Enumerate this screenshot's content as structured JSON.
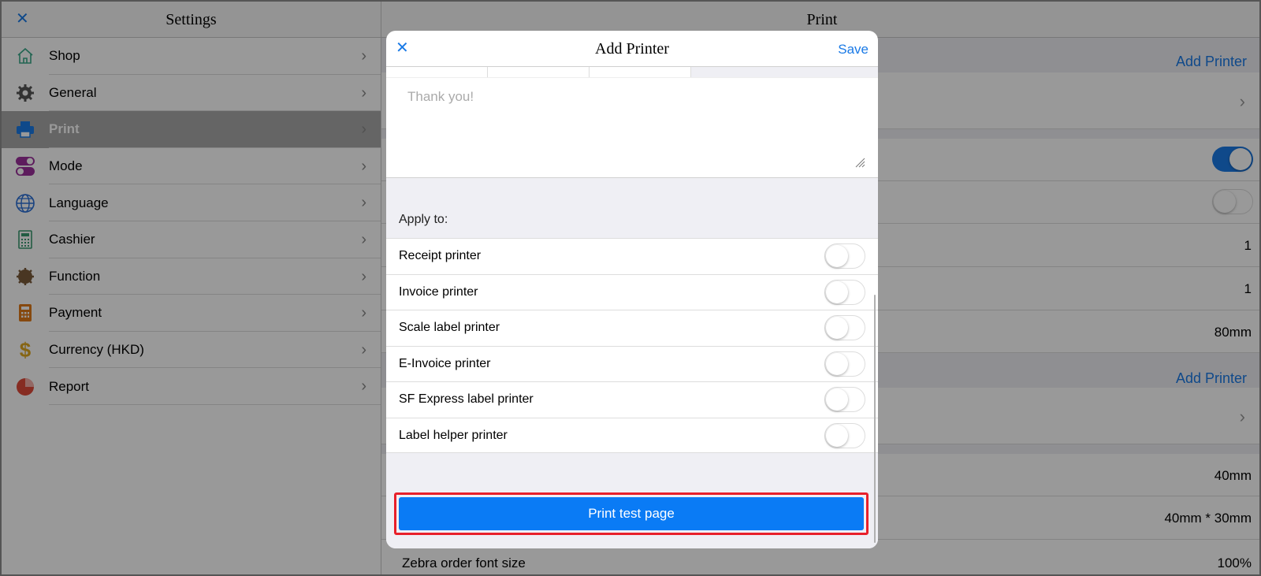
{
  "left_panel": {
    "title": "Settings",
    "items": [
      {
        "label": "Shop",
        "icon": "shop-icon",
        "color": "#3aa889"
      },
      {
        "label": "General",
        "icon": "gear-icon",
        "color": "#555555"
      },
      {
        "label": "Print",
        "icon": "printer-icon",
        "color": "#1a7ae6"
      },
      {
        "label": "Mode",
        "icon": "toggle-icon",
        "color": "#9b2f9b"
      },
      {
        "label": "Language",
        "icon": "globe-icon",
        "color": "#2a6fd6"
      },
      {
        "label": "Cashier",
        "icon": "calculator-icon",
        "color": "#3a9a70"
      },
      {
        "label": "Function",
        "icon": "cog-badge-icon",
        "color": "#7a5a3a"
      },
      {
        "label": "Payment",
        "icon": "payment-calculator-icon",
        "color": "#e07a1a"
      },
      {
        "label": "Currency (HKD)",
        "icon": "dollar-icon",
        "color": "#e0a820"
      },
      {
        "label": "Report",
        "icon": "pie-chart-icon",
        "color": "#e04a3a"
      }
    ]
  },
  "right_panel": {
    "title": "Print",
    "add_printer_1": "Add Printer",
    "add_printer_2": "Add Printer",
    "copies_1": "1",
    "copies_2": "1",
    "paper_width": "80mm",
    "label_width": "40mm",
    "label_size": "40mm * 30mm",
    "zebra_label": "Zebra order font size",
    "zebra_value": "100%",
    "toggle_1_on": true,
    "toggle_2_on": false
  },
  "modal": {
    "title": "Add Printer",
    "close": "×",
    "save": "Save",
    "textarea_placeholder": "Thank you!",
    "apply_to": "Apply to:",
    "printers": [
      {
        "label": "Receipt printer",
        "on": false
      },
      {
        "label": "Invoice printer",
        "on": false
      },
      {
        "label": "Scale label printer",
        "on": false
      },
      {
        "label": "E-Invoice printer",
        "on": false
      },
      {
        "label": "SF Express label printer",
        "on": false
      },
      {
        "label": "Label helper printer",
        "on": false
      }
    ],
    "test_button": "Print test page"
  }
}
